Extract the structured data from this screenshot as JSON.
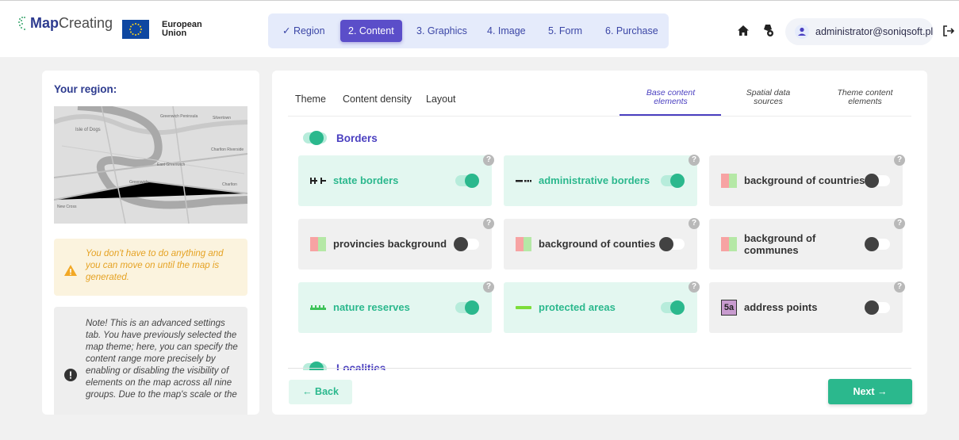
{
  "header": {
    "logo_strong": "Map",
    "logo_rest": "Creating",
    "eu_line1": "European",
    "eu_line2": "Union",
    "steps": [
      {
        "label": "✓ Region",
        "state": "done"
      },
      {
        "label": "2. Content",
        "state": "active"
      },
      {
        "label": "3. Graphics",
        "state": "todo"
      },
      {
        "label": "4. Image",
        "state": "todo"
      },
      {
        "label": "5. Form",
        "state": "todo"
      },
      {
        "label": "6. Purchase",
        "state": "todo"
      }
    ],
    "user_email": "administrator@soniqsoft.pl",
    "icons": [
      "home-icon",
      "settings-icon",
      "user-icon",
      "logout-icon"
    ]
  },
  "left": {
    "title": "Your region:",
    "map_labels": [
      "Greenwich Peninsula",
      "Isle of Dogs",
      "Silvertown",
      "Charlton Riverside",
      "East Greenwich",
      "Greenwich",
      "Charlton",
      "New Cross"
    ],
    "warning": "You don't have to do anything and you can move on until the map is generated.",
    "note": "Note! This is an advanced settings tab. You have previously selected the map theme; here, you can specify the content range more precisely by enabling or disabling the visibility of elements on the map across all nine groups. Due to the map's scale or the"
  },
  "tabs": {
    "left": [
      "Theme",
      "Content density",
      "Layout"
    ],
    "right": [
      {
        "line1": "Base content",
        "line2": "elements",
        "active": true
      },
      {
        "line1": "Spatial data",
        "line2": "sources",
        "active": false
      },
      {
        "line1": "Theme content",
        "line2": "elements",
        "active": false
      }
    ]
  },
  "group": {
    "title": "Borders",
    "enabled": true,
    "next_title": "Localities"
  },
  "elements": [
    {
      "label": "state borders",
      "enabled": true,
      "icon": "state-border-icon"
    },
    {
      "label": "administrative borders",
      "enabled": true,
      "icon": "admin-border-icon"
    },
    {
      "label": "background of countries",
      "enabled": false,
      "icon": "area-swatch-icon"
    },
    {
      "label": "provincies background",
      "enabled": false,
      "icon": "area-swatch-icon"
    },
    {
      "label": "background of counties",
      "enabled": false,
      "icon": "area-swatch-icon"
    },
    {
      "label": "background of communes",
      "enabled": false,
      "icon": "area-swatch-icon"
    },
    {
      "label": "nature reserves",
      "enabled": true,
      "icon": "nature-reserve-icon"
    },
    {
      "label": "protected areas",
      "enabled": true,
      "icon": "protected-area-icon"
    },
    {
      "label": "address points",
      "enabled": false,
      "icon": "address-point-icon",
      "icon_text": "5a"
    }
  ],
  "help_mark": "?",
  "buttons": {
    "back": "← Back",
    "next": "Next →"
  },
  "colors": {
    "accent": "#4a3fc0",
    "green": "#2bb88d",
    "warning": "#e5a223"
  }
}
